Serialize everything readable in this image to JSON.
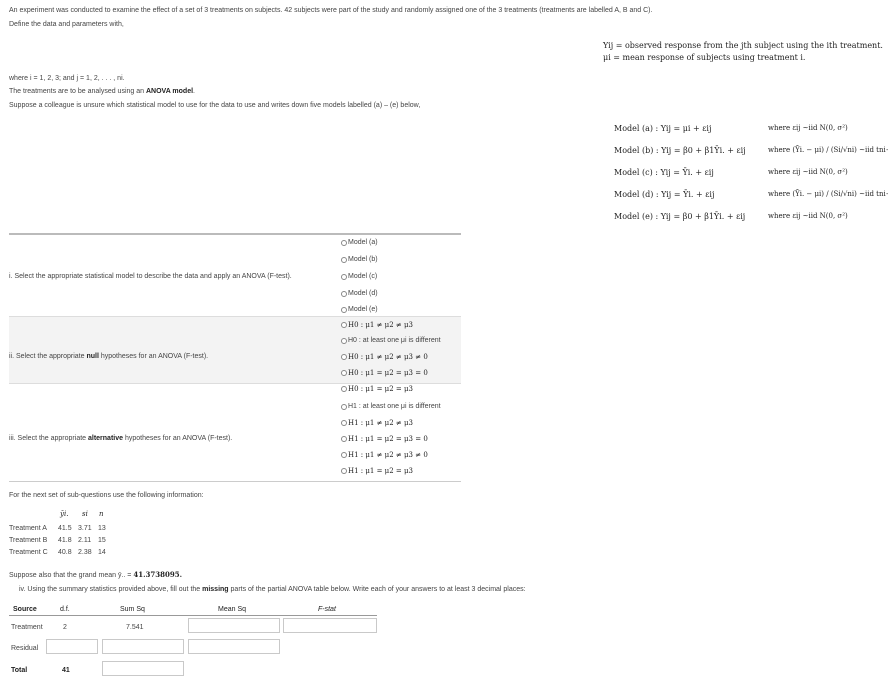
{
  "intro": {
    "line1": "An experiment was conducted to examine the effect of a set of 3 treatments on subjects. 42 subjects were part of the study and randomly assigned one of the 3 treatments (treatments are labelled A, B and C).",
    "line2": "Define the data and parameters with,",
    "def_y": "Yij = observed response from the jth subject using the ith treatment.",
    "def_mu": "μi = mean response of subjects using treatment i.",
    "where": "where i = 1, 2, 3; and j = 1, 2, . . . , ni.",
    "anova_prefix": "The treatments are to be analysed using an",
    "anova_bold": "ANOVA model",
    "colleague": "Suppose a colleague is unsure which statistical model to use for the data to use and writes down five models labelled (a) – (e) below,"
  },
  "models": [
    {
      "label": "Model (a) : Yij = μi + εij",
      "where": "where εij ~iid N(0, σ²)"
    },
    {
      "label": "Model (b) : Yij = β0 + β1Ȳi. + εij",
      "where": "where (Ȳi. − μi) / (Si/√ni) ~iid tni−1"
    },
    {
      "label": "Model (c) : Yij = Ȳi. + εij",
      "where": "where εij ~iid N(0, σ²)"
    },
    {
      "label": "Model (d) : Yij = Ȳi. + εij",
      "where": "where (Ȳi. − μi) / (Si/√ni) ~iid tni−1"
    },
    {
      "label": "Model (e) : Yij = β0 + β1Ȳi. + εij",
      "where": "where εij ~iid N(0, σ²)"
    }
  ],
  "q1": {
    "text": "i. Select the appropriate statistical model to describe the data and apply an ANOVA (F-test).",
    "options": [
      "Model (a)",
      "Model (b)",
      "Model (c)",
      "Model (d)",
      "Model (e)"
    ]
  },
  "q2": {
    "prefix": "ii. Select the appropriate",
    "bold": "null",
    "suffix": "hypotheses for an ANOVA (F-test).",
    "options": [
      "H0 : μ1 ≠ μ2 ≠ μ3",
      "H0 : at least one μi is different",
      "H0 : μ1 ≠ μ2 ≠ μ3 ≠ 0",
      "H0 : μ1 = μ2 = μ3 = 0",
      "H0 : μ1 = μ2 = μ3"
    ]
  },
  "q3": {
    "prefix": "iii. Select the appropriate",
    "bold": "alternative",
    "suffix": "hypotheses for an ANOVA (F-test).",
    "options": [
      "H1 : at least one μi is different",
      "H1 : μ1 ≠ μ2 ≠ μ3",
      "H1 : μ1 = μ2 = μ3 = 0",
      "H1 : μ1 ≠ μ2 ≠ μ3 ≠ 0",
      "H1 : μ1 = μ2 = μ3"
    ]
  },
  "summary": {
    "intro": "For the next set of sub-questions use the following information:",
    "headers": [
      "ȳi.",
      "si",
      "n"
    ],
    "rows": [
      {
        "name": "Treatment A",
        "mean": "41.5",
        "sd": "3.71",
        "n": "13"
      },
      {
        "name": "Treatment B",
        "mean": "41.8",
        "sd": "2.11",
        "n": "15"
      },
      {
        "name": "Treatment C",
        "mean": "40.8",
        "sd": "2.38",
        "n": "14"
      }
    ]
  },
  "grand_mean": {
    "prefix": "Suppose also that the grand mean ȳ.. =",
    "value": "41.3738095."
  },
  "q4": {
    "prefix": "iv. Using the summary statistics provided above, fill out the",
    "bold": "missing",
    "suffix": "parts of the partial ANOVA table below. Write each of your answers to at least 3 decimal places:"
  },
  "anova_table": {
    "headers": {
      "source": "Source",
      "df": "d.f.",
      "sumsq": "Sum Sq",
      "meansq": "Mean Sq",
      "fstat": "F-stat"
    },
    "treatment": {
      "source": "Treatment",
      "df": "2",
      "sumsq": "7.541"
    },
    "residual": {
      "source": "Residual"
    },
    "total": {
      "source": "Total",
      "df": "41"
    }
  }
}
